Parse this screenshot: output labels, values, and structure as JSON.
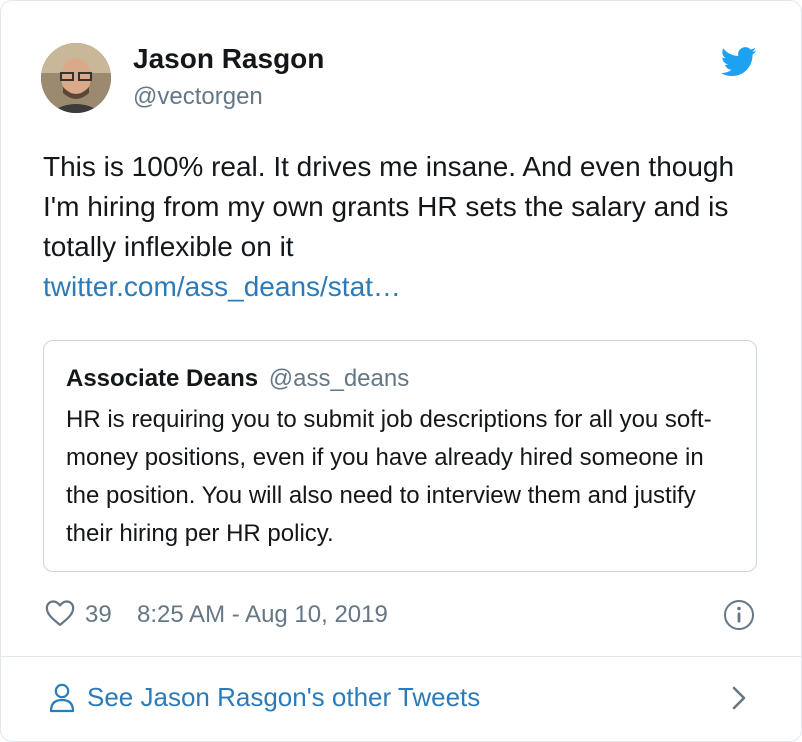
{
  "author": {
    "name": "Jason Rasgon",
    "handle": "@vectorgen"
  },
  "tweet": {
    "text": "This is 100% real. It drives me insane. And even though I'm hiring from my own grants HR sets the salary and is totally inflexible on it",
    "link": "twitter.com/ass_deans/stat…"
  },
  "quoted_tweet": {
    "name": "Associate Deans",
    "handle": "@ass_deans",
    "text": "HR is requiring you to submit job descriptions for all you soft-money positions, even if you have already hired someone in the position. You will also need to interview them and justify their hiring per HR policy."
  },
  "footer": {
    "like_count": "39",
    "timestamp": "8:25 AM - Aug 10, 2019"
  },
  "more_tweets_label": "See Jason Rasgon's other Tweets",
  "colors": {
    "link": "#2b7bb9",
    "secondary_text": "#657786",
    "twitter_blue": "#1da1f2"
  },
  "icons": [
    "avatar",
    "twitter-bird-icon",
    "heart-icon",
    "info-icon",
    "person-icon",
    "chevron-right-icon"
  ]
}
